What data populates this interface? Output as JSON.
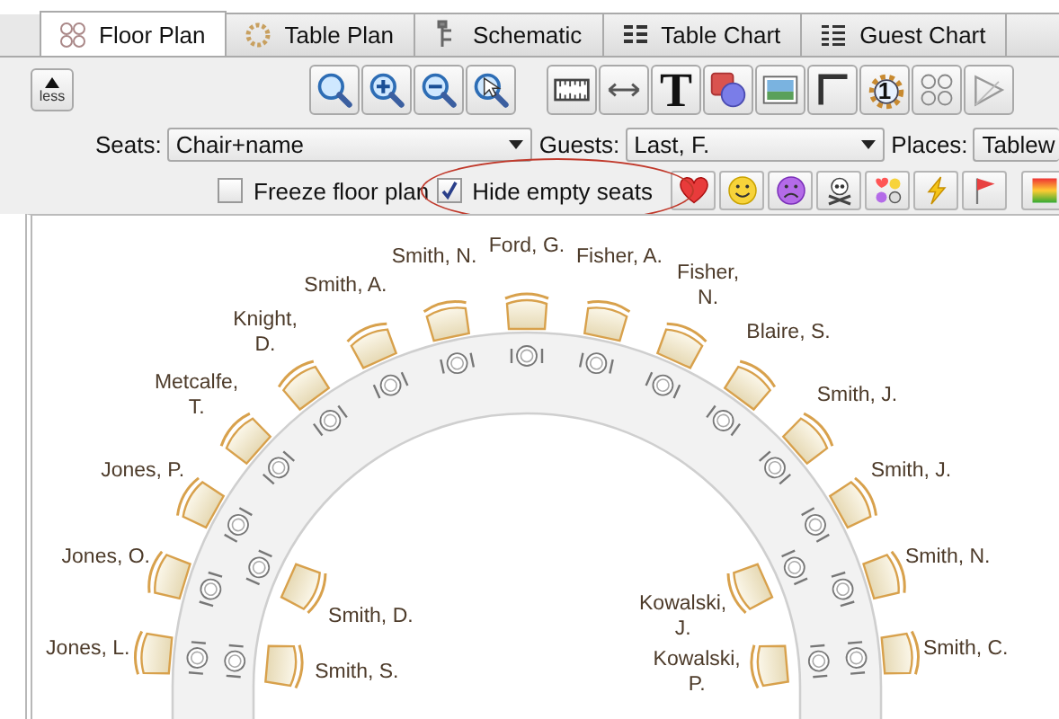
{
  "tabs": [
    {
      "label": "Floor Plan",
      "selected": true
    },
    {
      "label": "Table Plan",
      "selected": false
    },
    {
      "label": "Schematic",
      "selected": false
    },
    {
      "label": "Table Chart",
      "selected": false
    },
    {
      "label": "Guest Chart",
      "selected": false
    }
  ],
  "toolbar": {
    "less_button": "less",
    "text_tool": "T",
    "table_number": "1"
  },
  "selectors": [
    {
      "label": "Seats:",
      "value": "Chair+name"
    },
    {
      "label": "Guests:",
      "value": "Last, F."
    },
    {
      "label": "Places:",
      "value": "Tablew"
    }
  ],
  "options": [
    {
      "label": "Freeze floor plan",
      "checked": false
    },
    {
      "label": "Hide empty seats",
      "checked": true
    }
  ],
  "floor_plan": {
    "outer_left_seats": [
      {
        "name": "Ford, G."
      },
      {
        "name": "Smith, N."
      },
      {
        "name": "Smith, A."
      },
      {
        "name": "Knight,\nD."
      },
      {
        "name": "Metcalfe,\nT."
      },
      {
        "name": "Jones, P."
      },
      {
        "name": "Jones, O."
      },
      {
        "name": "Jones, L."
      }
    ],
    "outer_right_seats": [
      {
        "name": "Fisher, A."
      },
      {
        "name": "Fisher,\nN."
      },
      {
        "name": "Blaire, S."
      },
      {
        "name": "Smith, J."
      },
      {
        "name": "Smith, J."
      },
      {
        "name": "Smith, N."
      },
      {
        "name": "Smith, C."
      }
    ],
    "inner_seats": [
      {
        "name": "Smith, D."
      },
      {
        "name": "Smith, S."
      },
      {
        "name": "Kowalski,\nJ."
      },
      {
        "name": "Kowalski,\nP."
      }
    ]
  }
}
